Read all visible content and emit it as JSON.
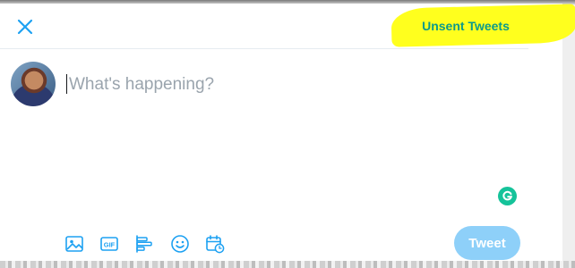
{
  "header": {
    "close_icon": "close-icon",
    "unsent_tweets_label": "Unsent Tweets",
    "highlight_color": "#ffff1e",
    "unsent_color": "#0c9a8a"
  },
  "composer": {
    "placeholder": "What's happening?",
    "value": ""
  },
  "toolbar": {
    "icons": [
      "image-icon",
      "gif-icon",
      "poll-icon",
      "emoji-icon",
      "schedule-icon"
    ],
    "gif_label": "GIF",
    "tweet_label": "Tweet",
    "accent_color": "#1da1f2",
    "tweet_disabled_color": "#8ed0f9"
  },
  "extensions": {
    "grammarly_icon": "grammarly-icon",
    "grammarly_color": "#15c39a"
  }
}
